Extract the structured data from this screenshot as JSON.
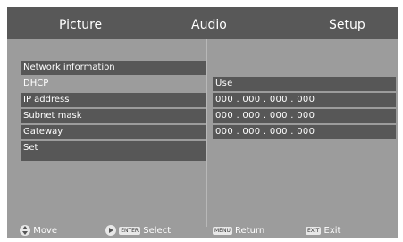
{
  "tabs": [
    {
      "label": "Picture"
    },
    {
      "label": "Audio"
    },
    {
      "label": "Setup"
    }
  ],
  "menu": {
    "items": [
      {
        "label": "Network information"
      },
      {
        "label": "DHCP"
      },
      {
        "label": "IP address"
      },
      {
        "label": "Subnet mask"
      },
      {
        "label": "Gateway"
      },
      {
        "label": "Set"
      }
    ],
    "values": [
      {
        "text": "Use"
      },
      {
        "text": "000 . 000 . 000 . 000"
      },
      {
        "text": "000 . 000 . 000 . 000"
      },
      {
        "text": "000 . 000 . 000 . 000"
      }
    ]
  },
  "footer": {
    "move_label": "Move",
    "enter_key": "ENTER",
    "select_label": "Select",
    "menu_key": "MENU",
    "return_label": "Return",
    "exit_key": "EXIT",
    "exit_label": "Exit"
  },
  "colors": {
    "background": "#9c9c9c",
    "tabbar": "#585858",
    "row": "#575757"
  }
}
